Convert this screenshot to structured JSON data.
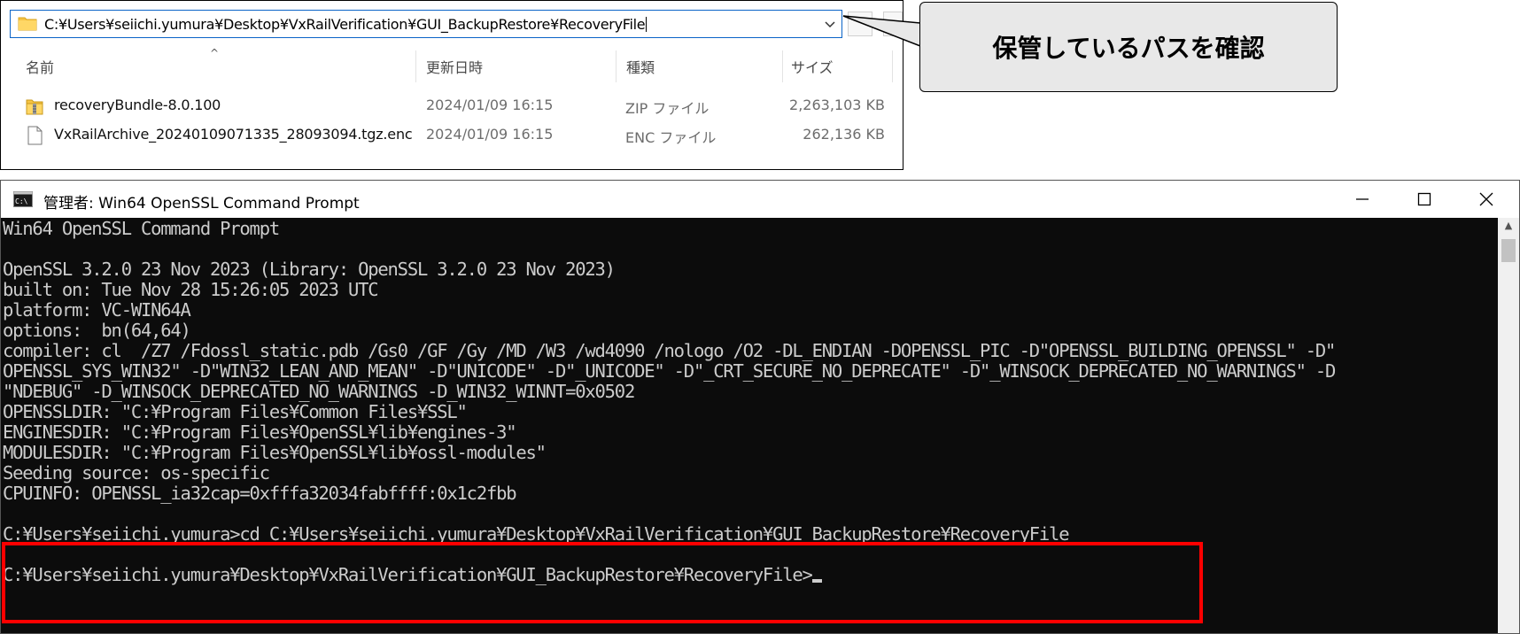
{
  "explorer": {
    "address_path": "C:¥Users¥seiichi.yumura¥Desktop¥VxRailVerification¥GUI_BackupRestore¥RecoveryFile",
    "columns": [
      "名前",
      "更新日時",
      "種類",
      "サイズ"
    ],
    "files": [
      {
        "name": "recoveryBundle-8.0.100",
        "date": "2024/01/09 16:15",
        "type": "ZIP ファイル",
        "size": "2,263,103 KB",
        "icon": "zip-folder-icon"
      },
      {
        "name": "VxRailArchive_20240109071335_28093094.tgz.enc",
        "date": "2024/01/09 16:15",
        "type": "ENC ファイル",
        "size": "262,136 KB",
        "icon": "file-icon"
      }
    ]
  },
  "callout": {
    "text": "保管しているパスを確認"
  },
  "cmd_window": {
    "title": "管理者: Win64 OpenSSL Command Prompt",
    "console_lines": [
      "Win64 OpenSSL Command Prompt",
      "",
      "OpenSSL 3.2.0 23 Nov 2023 (Library: OpenSSL 3.2.0 23 Nov 2023)",
      "built on: Tue Nov 28 15:26:05 2023 UTC",
      "platform: VC-WIN64A",
      "options:  bn(64,64)",
      "compiler: cl  /Z7 /Fdossl_static.pdb /Gs0 /GF /Gy /MD /W3 /wd4090 /nologo /O2 -DL_ENDIAN -DOPENSSL_PIC -D\"OPENSSL_BUILDING_OPENSSL\" -D\"",
      "OPENSSL_SYS_WIN32\" -D\"WIN32_LEAN_AND_MEAN\" -D\"UNICODE\" -D\"_UNICODE\" -D\"_CRT_SECURE_NO_DEPRECATE\" -D\"_WINSOCK_DEPRECATED_NO_WARNINGS\" -D",
      "\"NDEBUG\" -D_WINSOCK_DEPRECATED_NO_WARNINGS -D_WIN32_WINNT=0x0502",
      "OPENSSLDIR: \"C:¥Program Files¥Common Files¥SSL\"",
      "ENGINESDIR: \"C:¥Program Files¥OpenSSL¥lib¥engines-3\"",
      "MODULESDIR: \"C:¥Program Files¥OpenSSL¥lib¥ossl-modules\"",
      "Seeding source: os-specific",
      "CPUINFO: OPENSSL_ia32cap=0xfffa32034fabffff:0x1c2fbb",
      "",
      "C:¥Users¥seiichi.yumura>cd C:¥Users¥seiichi.yumura¥Desktop¥VxRailVerification¥GUI_BackupRestore¥RecoveryFile",
      "",
      "C:¥Users¥seiichi.yumura¥Desktop¥VxRailVerification¥GUI_BackupRestore¥RecoveryFile>"
    ]
  },
  "colors": {
    "highlight_box": "#ff0000",
    "console_bg": "#0c0c0c",
    "console_text": "#cccccc",
    "callout_bg": "#e8e8e8",
    "address_border": "#0a64c8"
  }
}
